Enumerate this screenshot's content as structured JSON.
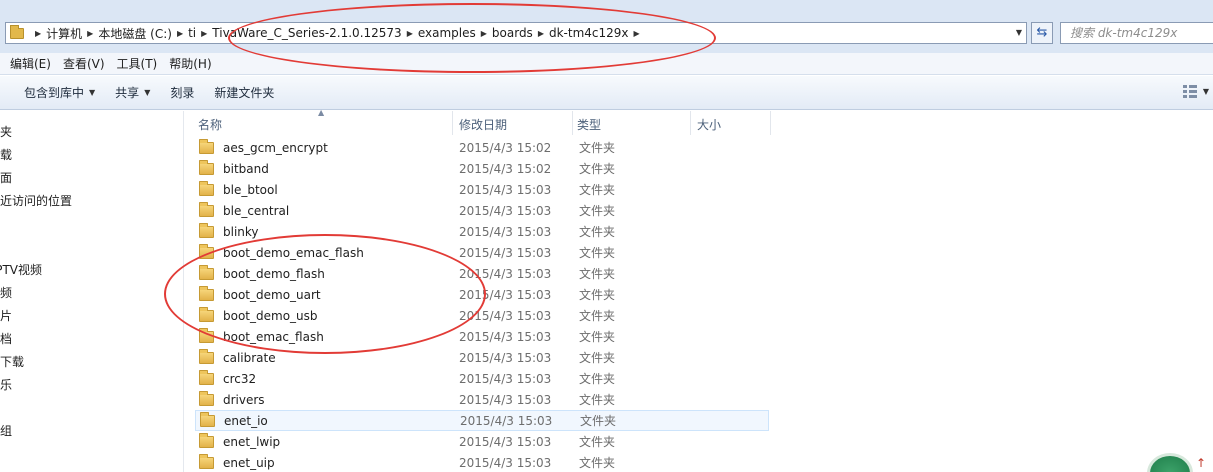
{
  "address": {
    "crumbs": [
      "计算机",
      "本地磁盘 (C:)",
      "ti",
      "TivaWare_C_Series-2.1.0.12573",
      "examples",
      "boards",
      "dk-tm4c129x"
    ]
  },
  "search": {
    "placeholder": "搜索 dk-tm4c129x"
  },
  "menu": [
    "编辑(E)",
    "查看(V)",
    "工具(T)",
    "帮助(H)"
  ],
  "toolbar": {
    "include_library": "包含到库中",
    "share": "共享",
    "burn": "刻录",
    "new_folder": "新建文件夹"
  },
  "nav": [
    "藏夹",
    "下载",
    "桌面",
    "最近访问的位置",
    "PPTV视频",
    "视频",
    "图片",
    "文档",
    "迅雷下载",
    "音乐",
    "家庭组"
  ],
  "columns": {
    "name": "名称",
    "date": "修改日期",
    "type": "类型",
    "size": "大小"
  },
  "files": [
    {
      "name": "aes_gcm_encrypt",
      "date": "2015/4/3 15:02",
      "type": "文件夹"
    },
    {
      "name": "bitband",
      "date": "2015/4/3 15:02",
      "type": "文件夹"
    },
    {
      "name": "ble_btool",
      "date": "2015/4/3 15:03",
      "type": "文件夹"
    },
    {
      "name": "ble_central",
      "date": "2015/4/3 15:03",
      "type": "文件夹"
    },
    {
      "name": "blinky",
      "date": "2015/4/3 15:03",
      "type": "文件夹"
    },
    {
      "name": "boot_demo_emac_flash",
      "date": "2015/4/3 15:03",
      "type": "文件夹"
    },
    {
      "name": "boot_demo_flash",
      "date": "2015/4/3 15:03",
      "type": "文件夹"
    },
    {
      "name": "boot_demo_uart",
      "date": "2015/4/3 15:03",
      "type": "文件夹"
    },
    {
      "name": "boot_demo_usb",
      "date": "2015/4/3 15:03",
      "type": "文件夹"
    },
    {
      "name": "boot_emac_flash",
      "date": "2015/4/3 15:03",
      "type": "文件夹"
    },
    {
      "name": "calibrate",
      "date": "2015/4/3 15:03",
      "type": "文件夹"
    },
    {
      "name": "crc32",
      "date": "2015/4/3 15:03",
      "type": "文件夹"
    },
    {
      "name": "drivers",
      "date": "2015/4/3 15:03",
      "type": "文件夹"
    },
    {
      "name": "enet_io",
      "date": "2015/4/3 15:03",
      "type": "文件夹"
    },
    {
      "name": "enet_lwip",
      "date": "2015/4/3 15:03",
      "type": "文件夹"
    },
    {
      "name": "enet_uip",
      "date": "2015/4/3 15:03",
      "type": "文件夹"
    }
  ],
  "annotation_color": "#e23b36"
}
